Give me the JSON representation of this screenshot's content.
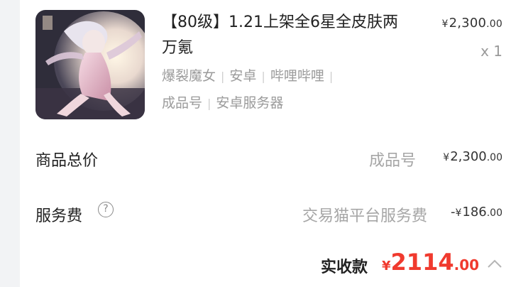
{
  "product": {
    "title": "【80级】1.21上架全6星全皮肤两万氪",
    "price": {
      "currency": "¥",
      "integer": "2,300",
      "decimal": ".00"
    },
    "quantity": "x 1",
    "tags_line1": [
      "爆裂魔女",
      "安卓",
      "哔哩哔哩"
    ],
    "tags_line2": [
      "成品号",
      "安卓服务器"
    ],
    "image_icon": "character-artwork"
  },
  "total": {
    "label": "商品总价",
    "sub": "成品号",
    "price": {
      "currency": "¥",
      "integer": "2,300",
      "decimal": ".00"
    }
  },
  "service_fee": {
    "label": "服务费",
    "help_icon": "?",
    "sub": "交易猫平台服务费",
    "price": {
      "prefix": "-",
      "currency": "¥",
      "integer": "186",
      "decimal": ".00"
    }
  },
  "payment": {
    "label": "实收款",
    "currency": "¥",
    "integer": "2114",
    "decimal": ".00",
    "color": "#f03a2e"
  }
}
